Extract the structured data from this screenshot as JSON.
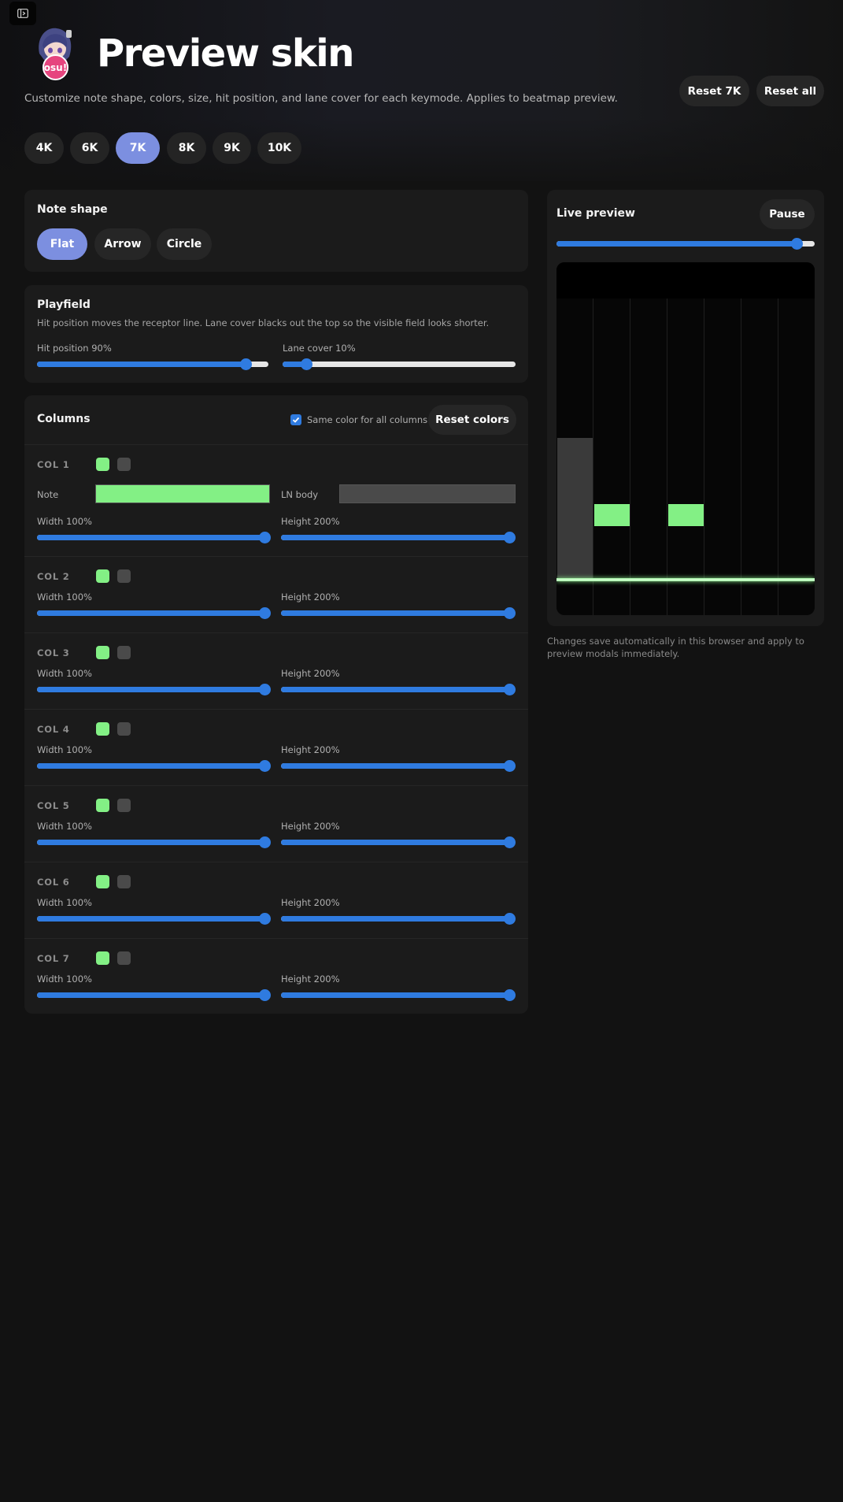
{
  "header": {
    "title": "Preview skin",
    "subtitle": "Customize note shape, colors, size, hit position, and lane cover for each keymode. Applies to beatmap preview.",
    "logo_text": "osu!",
    "reset_mode_label": "Reset 7K",
    "reset_all_label": "Reset all"
  },
  "keymodes": {
    "items": [
      "4K",
      "6K",
      "7K",
      "8K",
      "9K",
      "10K"
    ],
    "selected": "7K"
  },
  "note_shape": {
    "title": "Note shape",
    "options": [
      "Flat",
      "Arrow",
      "Circle"
    ],
    "selected": "Flat"
  },
  "playfield": {
    "title": "Playfield",
    "description": "Hit position moves the receptor line. Lane cover blacks out the top so the visible field looks shorter.",
    "hit_position_label": "Hit position 90%",
    "hit_position": 0.9,
    "lane_cover_label": "Lane cover 10%",
    "lane_cover": 0.1
  },
  "columns": {
    "title": "Columns",
    "same_color_label": "Same color for all columns",
    "same_color_checked": true,
    "reset_colors_label": "Reset colors",
    "note_label": "Note",
    "ln_body_label": "LN body",
    "note_color": "#83f085",
    "ln_color": "#4a4a4a",
    "items": [
      {
        "label": "COL 1",
        "width_label": "Width 100%",
        "height_label": "Height 200%",
        "width": 1.0,
        "height": 1.0
      },
      {
        "label": "COL 2",
        "width_label": "Width 100%",
        "height_label": "Height 200%",
        "width": 1.0,
        "height": 1.0
      },
      {
        "label": "COL 3",
        "width_label": "Width 100%",
        "height_label": "Height 200%",
        "width": 1.0,
        "height": 1.0
      },
      {
        "label": "COL 4",
        "width_label": "Width 100%",
        "height_label": "Height 200%",
        "width": 1.0,
        "height": 1.0
      },
      {
        "label": "COL 5",
        "width_label": "Width 100%",
        "height_label": "Height 200%",
        "width": 1.0,
        "height": 1.0
      },
      {
        "label": "COL 6",
        "width_label": "Width 100%",
        "height_label": "Height 200%",
        "width": 1.0,
        "height": 1.0
      },
      {
        "label": "COL 7",
        "width_label": "Width 100%",
        "height_label": "Height 200%",
        "width": 1.0,
        "height": 1.0
      }
    ]
  },
  "live_preview": {
    "title": "Live preview",
    "pause_label": "Pause",
    "progress": 0.93,
    "footnote": "Changes save automatically in this browser and apply to preview modals immediately."
  },
  "colors": {
    "accent": "#7c8fe0",
    "slider": "#2f7be0",
    "note": "#83f085"
  }
}
